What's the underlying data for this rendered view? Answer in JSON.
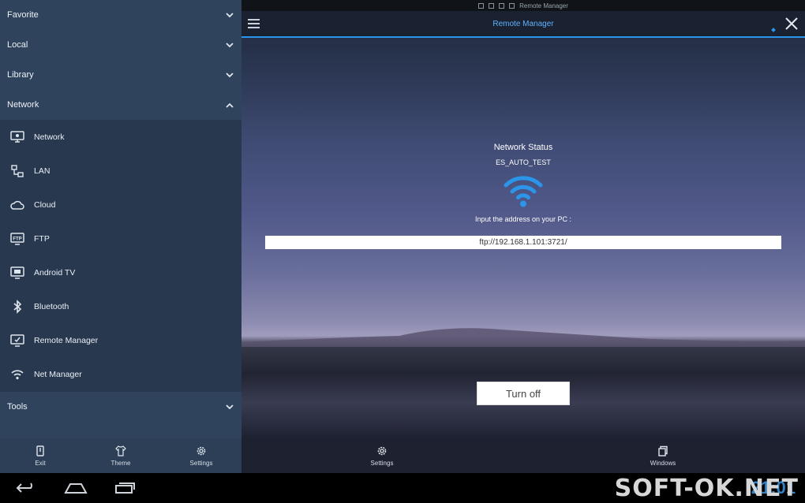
{
  "sidebar": {
    "sections": {
      "favorite": "Favorite",
      "local": "Local",
      "library": "Library",
      "network": "Network",
      "tools": "Tools"
    },
    "network_items": [
      {
        "label": "Network",
        "icon": "monitor-network-icon"
      },
      {
        "label": "LAN",
        "icon": "lan-icon"
      },
      {
        "label": "Cloud",
        "icon": "cloud-icon"
      },
      {
        "label": "FTP",
        "icon": "ftp-icon"
      },
      {
        "label": "Android TV",
        "icon": "tv-icon"
      },
      {
        "label": "Bluetooth",
        "icon": "bluetooth-icon"
      },
      {
        "label": "Remote Manager",
        "icon": "remote-manager-icon"
      },
      {
        "label": "Net Manager",
        "icon": "wifi-icon"
      }
    ],
    "toolbar": {
      "exit": "Exit",
      "theme": "Theme",
      "settings": "Settings"
    }
  },
  "statusbar": {
    "title": "Remote Manager"
  },
  "titlebar": {
    "title": "Remote Manager"
  },
  "content": {
    "network_status_label": "Network Status",
    "ssid": "ES_AUTO_TEST",
    "hint": "Input the address on your PC :",
    "address": "ftp://192.168.1.101:3721/",
    "turn_off": "Turn off"
  },
  "main_toolbar": {
    "settings": "Settings",
    "windows": "Windows"
  },
  "navbar": {
    "watermark": "SOFT-OK.NET",
    "clock": "21:01"
  },
  "colors": {
    "accent": "#2b95e9",
    "sidebar_bg": "#2f435c",
    "sidebar_list_bg": "#28394f"
  }
}
